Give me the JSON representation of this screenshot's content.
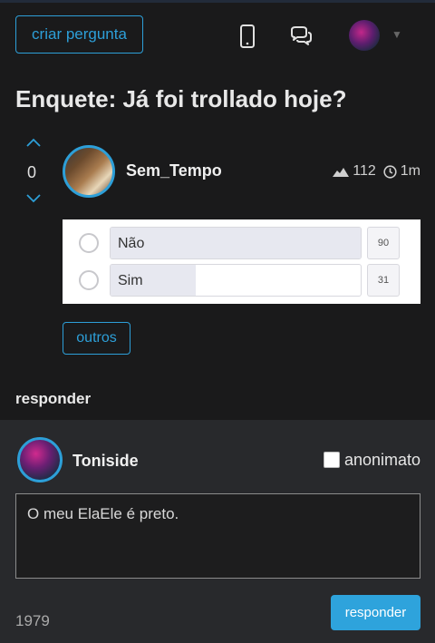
{
  "header": {
    "create_label": "criar pergunta",
    "icons": [
      "mobile-phone-icon",
      "chat-bubbles-icon"
    ],
    "accent": "#2d9fd8"
  },
  "post": {
    "title": "Enquete: Já foi trollado hoje?",
    "votes": "0",
    "author": "Sem_Tempo",
    "views": "112",
    "age": "1m"
  },
  "poll": {
    "options": [
      {
        "label": "Não",
        "count": "90",
        "fraction": 1.0
      },
      {
        "label": "Sim",
        "count": "31",
        "fraction": 0.34
      }
    ]
  },
  "actions": {
    "others_label": "outros"
  },
  "reply": {
    "heading": "responder",
    "username": "Toniside",
    "anon_label": "anonimato",
    "text": "O meu ElaEle é preto.",
    "char_count": "1979",
    "submit_label": "responder",
    "submit_color": "#2ea3dc"
  }
}
